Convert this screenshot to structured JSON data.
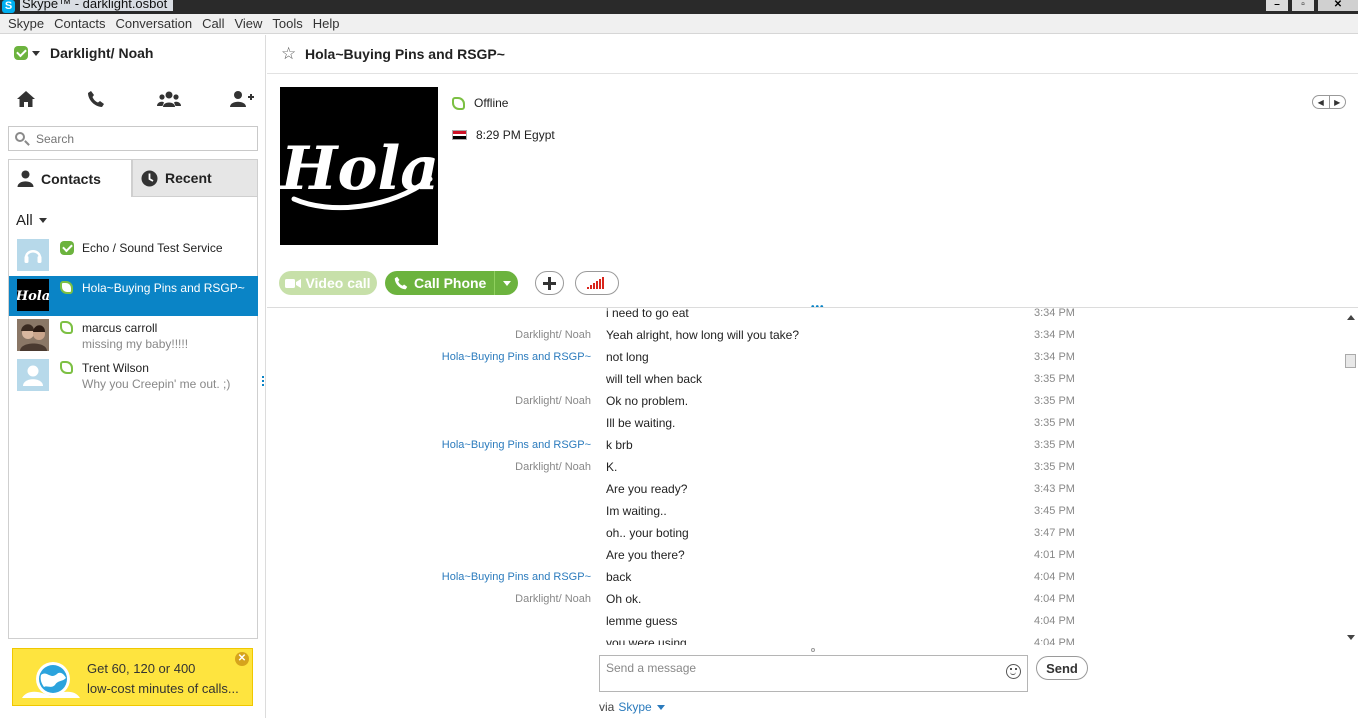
{
  "window": {
    "title": "Skype™ - darklight.osbot"
  },
  "menu": [
    "Skype",
    "Contacts",
    "Conversation",
    "Call",
    "View",
    "Tools",
    "Help"
  ],
  "profile": {
    "name": "Darklight/ Noah"
  },
  "search": {
    "placeholder": "Search"
  },
  "tabs": {
    "contacts": "Contacts",
    "recent": "Recent"
  },
  "filter": {
    "label": "All"
  },
  "contacts": [
    {
      "name": "Echo / Sound Test Service",
      "mood": "",
      "status": "online"
    },
    {
      "name": "Hola~Buying Pins and RSGP~",
      "mood": "",
      "status": "offline",
      "selected": true
    },
    {
      "name": "marcus carroll",
      "mood": "missing my baby!!!!!",
      "status": "offline"
    },
    {
      "name": "Trent Wilson",
      "mood": "Why you Creepin' me out. ;)",
      "status": "offline"
    }
  ],
  "promo": {
    "line1": "Get 60, 120 or 400",
    "line2": "low-cost minutes of calls..."
  },
  "conversation": {
    "title": "Hola~Buying Pins and RSGP~",
    "avatar_text": "Hola",
    "status": "Offline",
    "local_time": "8:29 PM Egypt",
    "video_call_label": "Video call",
    "call_phone_label": "Call Phone"
  },
  "messages": [
    {
      "sender": "",
      "text": "i need to go eat",
      "time": "3:34 PM",
      "from": "them"
    },
    {
      "sender": "Darklight/ Noah",
      "text": "Yeah alright, how long will you take?",
      "time": "3:34 PM",
      "from": "me"
    },
    {
      "sender": "Hola~Buying Pins and RSGP~",
      "text": "not long",
      "time": "3:34 PM",
      "from": "them"
    },
    {
      "sender": "",
      "text": "will tell when back",
      "time": "3:35 PM",
      "from": "them"
    },
    {
      "sender": "Darklight/ Noah",
      "text": "Ok no problem.",
      "time": "3:35 PM",
      "from": "me"
    },
    {
      "sender": "",
      "text": "Ill be waiting.",
      "time": "3:35 PM",
      "from": "me"
    },
    {
      "sender": "Hola~Buying Pins and RSGP~",
      "text": "k brb",
      "time": "3:35 PM",
      "from": "them"
    },
    {
      "sender": "Darklight/ Noah",
      "text": "K.",
      "time": "3:35 PM",
      "from": "me"
    },
    {
      "sender": "",
      "text": "Are you ready?",
      "time": "3:43 PM",
      "from": "me"
    },
    {
      "sender": "",
      "text": "Im waiting..",
      "time": "3:45 PM",
      "from": "me"
    },
    {
      "sender": "",
      "text": "oh.. your boting",
      "time": "3:47 PM",
      "from": "me"
    },
    {
      "sender": "",
      "text": "Are you there?",
      "time": "4:01 PM",
      "from": "me"
    },
    {
      "sender": "Hola~Buying Pins and RSGP~",
      "text": "back",
      "time": "4:04 PM",
      "from": "them"
    },
    {
      "sender": "Darklight/ Noah",
      "text": "Oh ok.",
      "time": "4:04 PM",
      "from": "me"
    },
    {
      "sender": "",
      "text": "lemme guess",
      "time": "4:04 PM",
      "from": "me"
    },
    {
      "sender": "",
      "text": "you were using",
      "time": "4:04 PM",
      "from": "me"
    }
  ],
  "composer": {
    "placeholder": "Send a message",
    "send_label": "Send",
    "via_label": "via",
    "via_service": "Skype"
  }
}
